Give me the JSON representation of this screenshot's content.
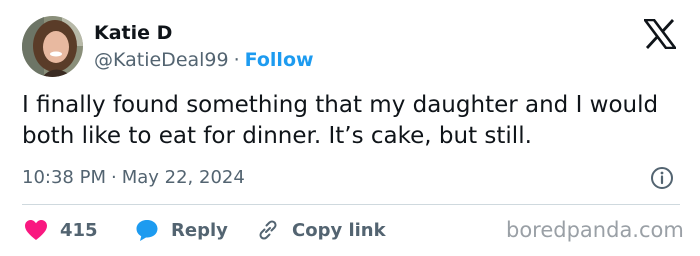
{
  "author": {
    "display_name": "Katie D",
    "handle": "@KatieDeal99",
    "separator": "·",
    "follow_label": "Follow"
  },
  "tweet": {
    "text": "I finally found something that my daughter and I would both like to eat for dinner. It’s cake, but still.",
    "time": "10:38 PM",
    "separator": "·",
    "date": "May 22, 2024"
  },
  "actions": {
    "like_count": "415",
    "reply_label": "Reply",
    "copy_link_label": "Copy link"
  },
  "watermark": "boredpanda.com",
  "colors": {
    "accent": "#1d9bf0",
    "like": "#f91880",
    "text_primary": "#0f1419",
    "text_secondary": "#536471"
  },
  "icons": {
    "brand": "x-logo-icon",
    "info": "info-icon",
    "like": "heart-icon",
    "reply": "speech-bubble-icon",
    "copy_link": "link-icon"
  }
}
